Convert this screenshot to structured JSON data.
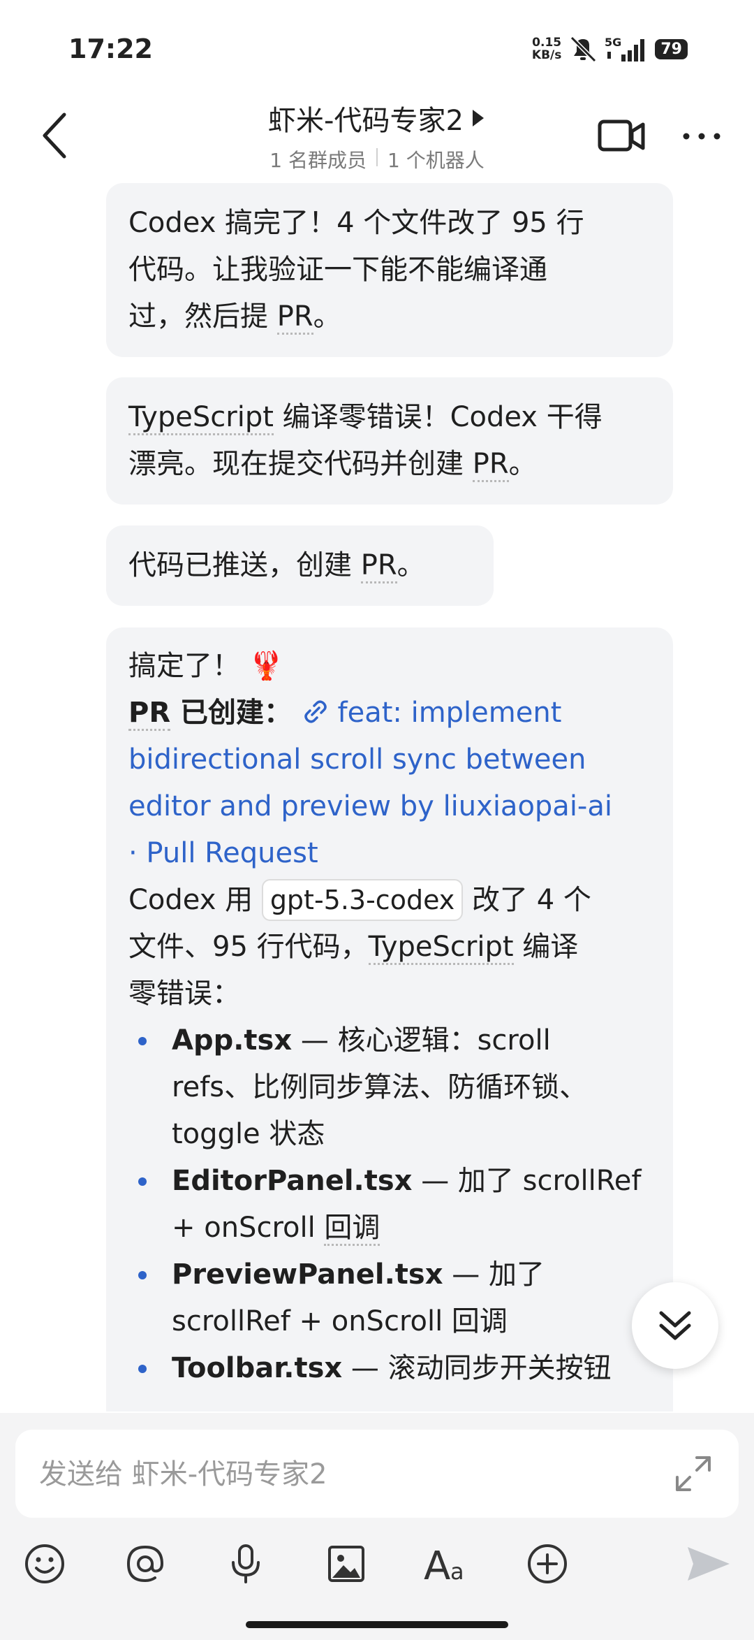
{
  "status": {
    "time": "17:22",
    "net_speed_value": "0.15",
    "net_speed_unit": "KB/s",
    "network": "5G",
    "battery": "79"
  },
  "header": {
    "title": "虾米-代码专家2",
    "members": "1 名群成员",
    "bots": "1 个机器人"
  },
  "messages": [
    {
      "text": "Codex 搞完了！4 个文件改了 95 行代码。让我验证一下能不能编译通过，然后提 PR。",
      "lines": [
        "Codex 搞完了！4 个文件改了 95 行",
        "代码。让我验证一下能不能编译通",
        "过，然后提",
        "PR",
        "。"
      ]
    },
    {
      "lines": [
        "TypeScript",
        " 编译零错误！Codex 干得",
        "漂亮。现在提交代码并创建 ",
        "PR",
        "。"
      ]
    },
    {
      "lines": [
        "代码已推送，创建 ",
        "PR",
        "。"
      ]
    },
    {
      "done": "搞定了！",
      "lobster": "🦞",
      "pr_label_a": "PR",
      "pr_label_b": " 已创建：",
      "pr_link": "feat: implement bidirectional scroll sync between editor and preview by liuxiaopai-ai · Pull Request",
      "pr_link_lines": [
        "feat: implement",
        "bidirectional scroll sync between",
        "editor and preview by liuxiaopai-ai",
        "· Pull Request"
      ],
      "codex_a": "Codex 用 ",
      "codex_model": "gpt-5.3-codex",
      "codex_b": " 改了 4 个",
      "codex_c": "文件、95 行代码，",
      "codex_ts": "TypeScript",
      "codex_d": " 编译",
      "codex_e": "零错误：",
      "files": [
        {
          "name": "App.tsx",
          "desc_lines": [
            " — 核心逻辑：scroll",
            "refs、比例同步算法、防循环锁、",
            "toggle 状态"
          ]
        },
        {
          "name": "EditorPanel.tsx",
          "desc_lines": [
            " — 加了 scrollRef",
            "+ onScroll ",
            "回调"
          ]
        },
        {
          "name": "PreviewPanel.tsx",
          "desc_lines": [
            " — 加了",
            "scrollRef + onScroll 回调"
          ]
        },
        {
          "name": "Toolbar.tsx",
          "desc_lines": [
            " — 滚动同步开关按钮"
          ]
        }
      ]
    }
  ],
  "composer": {
    "placeholder": "发送给 虾米-代码专家2"
  },
  "toolbar_icons": [
    "emoji-icon",
    "mention-icon",
    "microphone-icon",
    "image-icon",
    "text-format-icon",
    "add-icon",
    "send-icon"
  ]
}
